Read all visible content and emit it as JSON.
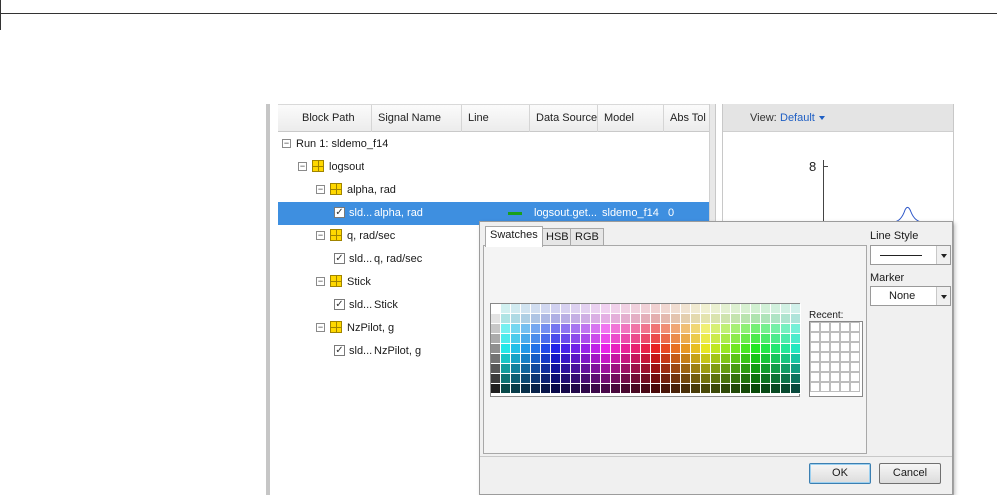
{
  "table": {
    "columns": [
      "Block Path",
      "Signal Name",
      "Line",
      "Data Source",
      "Model",
      "Abs Tol"
    ],
    "rows": [
      {
        "label": "Run 1: sldemo_f14",
        "level": 0,
        "kind": "run"
      },
      {
        "label": "logsout",
        "level": 1,
        "kind": "group"
      },
      {
        "label": "alpha, rad",
        "level": 2,
        "kind": "group"
      },
      {
        "block": "sld...",
        "signal": "alpha, rad",
        "data_source": "logsout.get...",
        "model": "sldemo_f14",
        "abs_tol": "0",
        "level": 3,
        "kind": "signal",
        "selected": true
      },
      {
        "label": "q, rad/sec",
        "level": 2,
        "kind": "group"
      },
      {
        "block": "sld...",
        "signal": "q, rad/sec",
        "level": 3,
        "kind": "signal"
      },
      {
        "label": "Stick",
        "level": 2,
        "kind": "group"
      },
      {
        "block": "sld...",
        "signal": "Stick",
        "level": 3,
        "kind": "signal"
      },
      {
        "label": "NzPilot, g",
        "level": 2,
        "kind": "group"
      },
      {
        "block": "sld...",
        "signal": "NzPilot, g",
        "level": 3,
        "kind": "signal"
      }
    ]
  },
  "plot": {
    "view_label": "View:",
    "view_value": "Default",
    "y_tick": "8"
  },
  "dialog": {
    "tabs": [
      "Swatches",
      "HSB",
      "RGB"
    ],
    "recent_label": "Recent:",
    "line_style_label": "Line Style",
    "marker_label": "Marker",
    "marker_value": "None",
    "ok_label": "OK",
    "cancel_label": "Cancel"
  },
  "colors": {
    "selection": "#3e8fe0",
    "line_sample": "#1aa01a",
    "link": "#1f5fc4"
  }
}
